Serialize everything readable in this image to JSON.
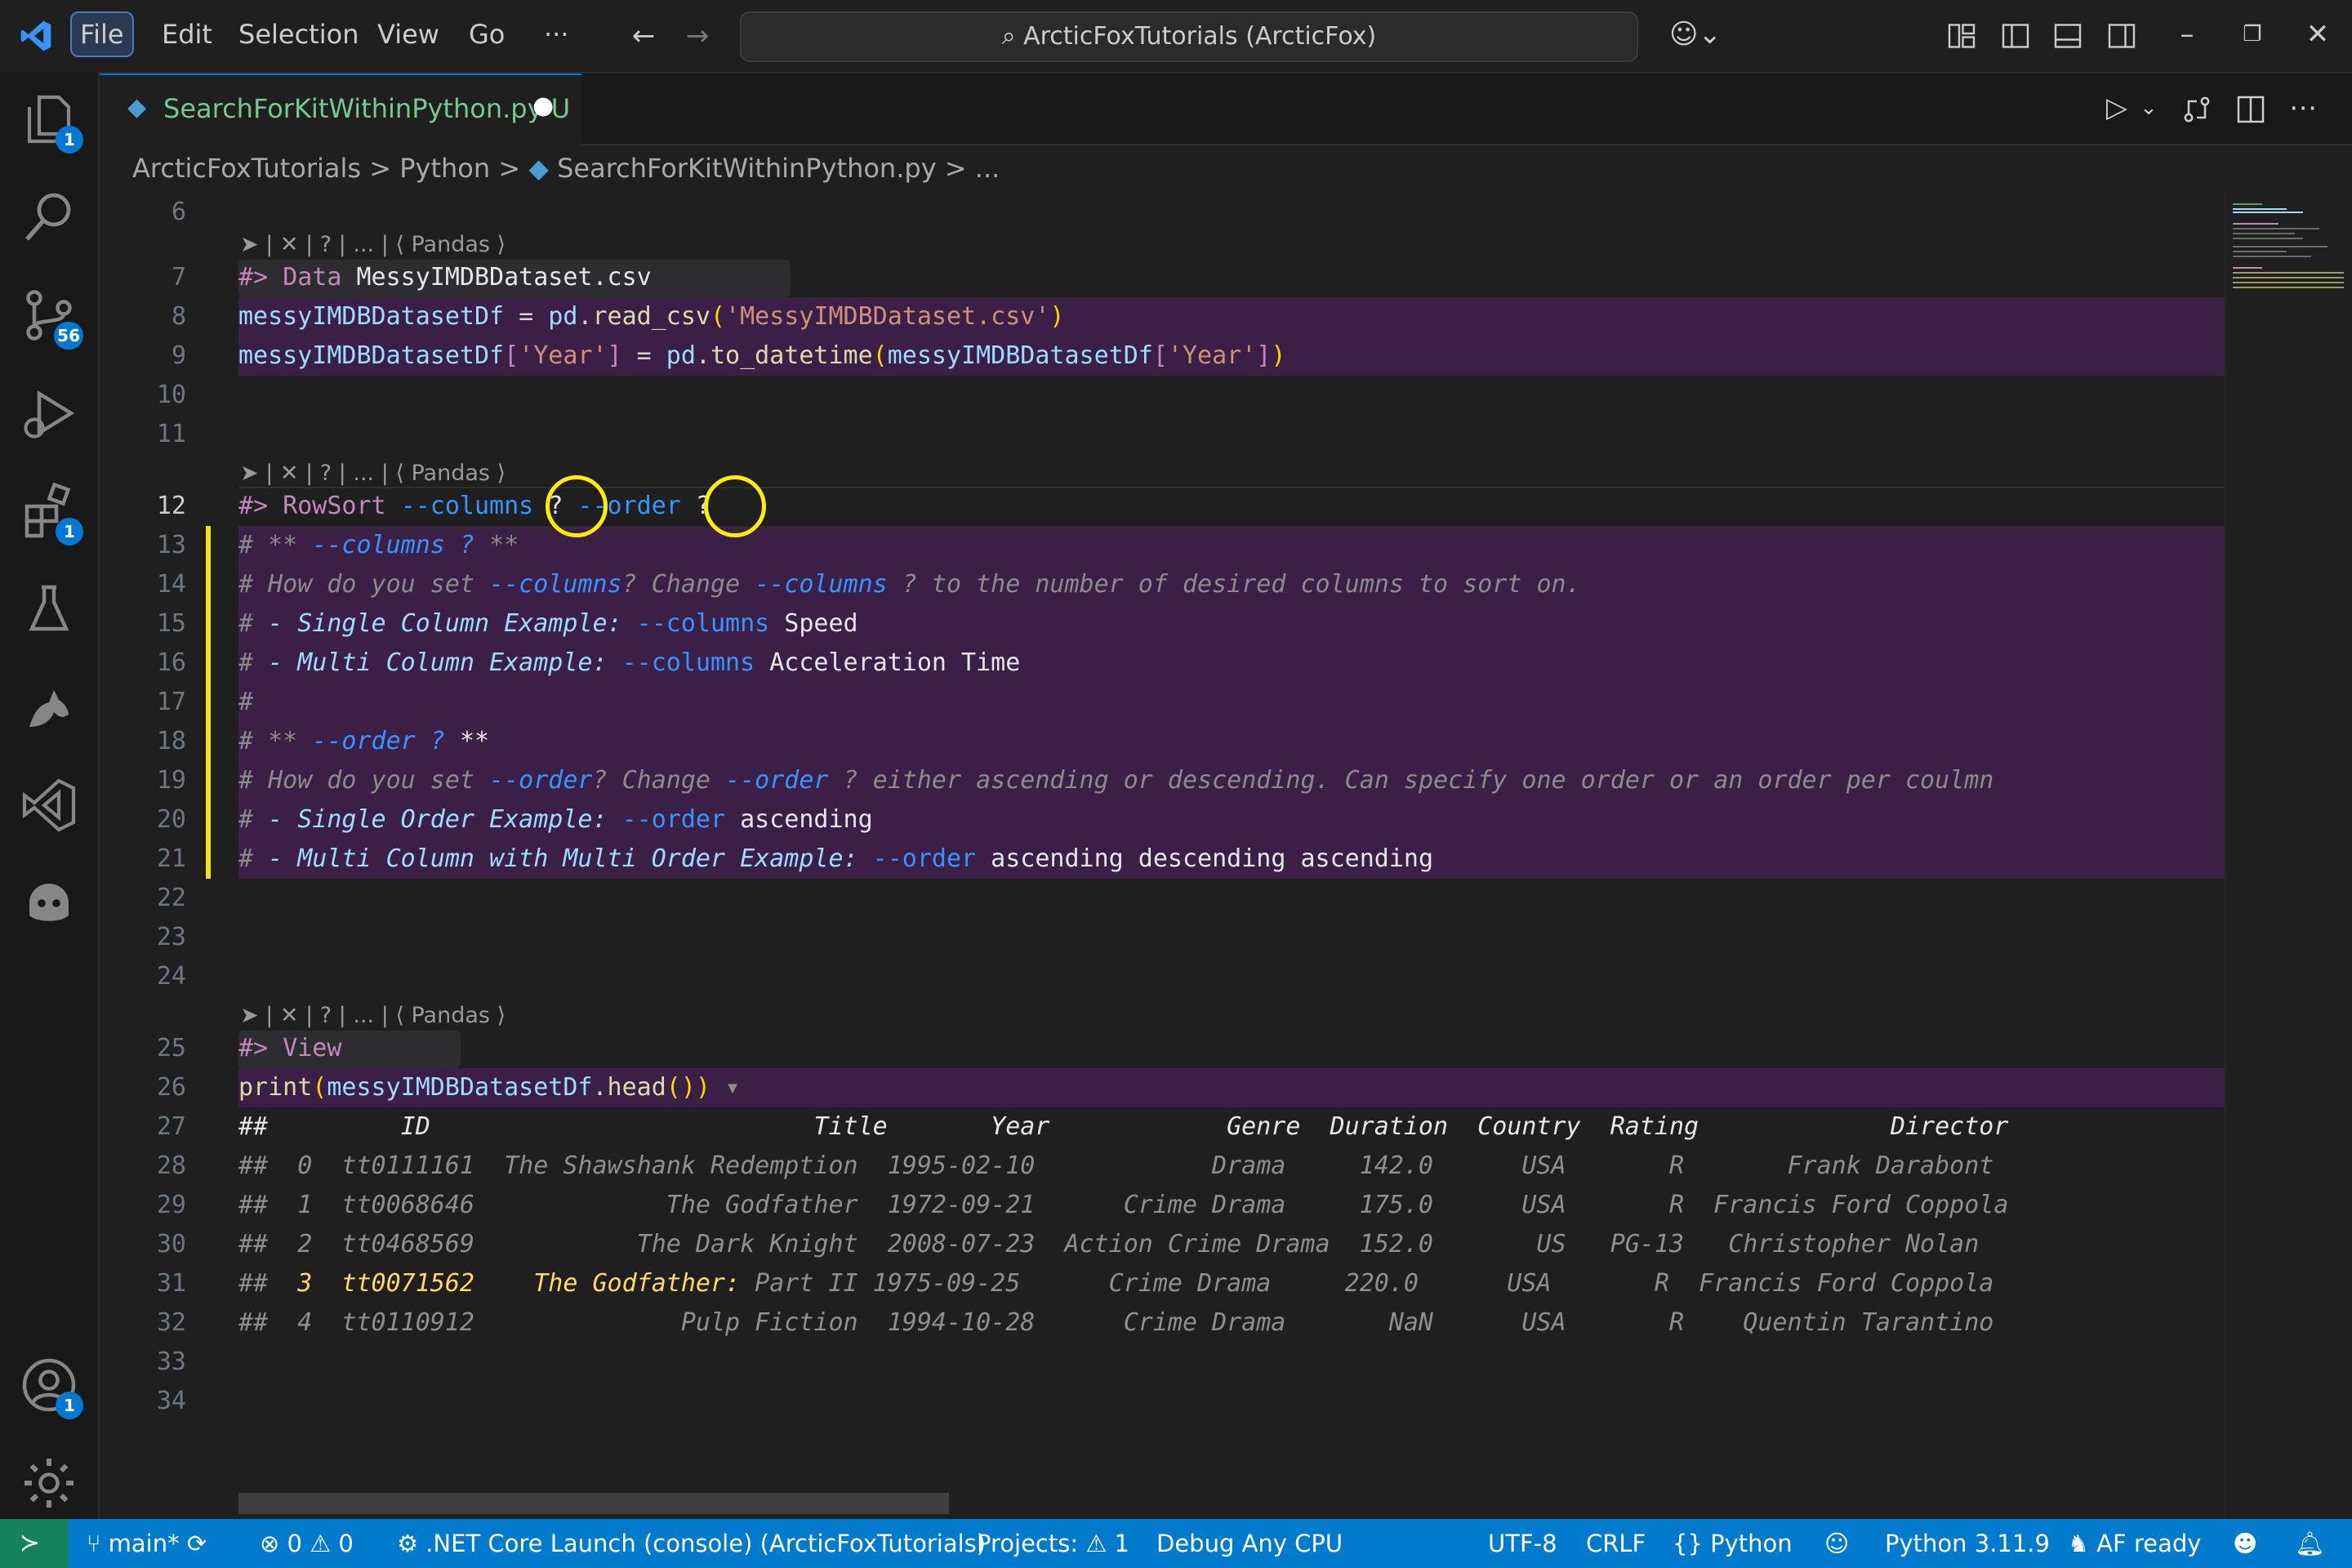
{
  "titlebar": {
    "menu": [
      "File",
      "Edit",
      "Selection",
      "View",
      "Go",
      "···"
    ],
    "search_text": "ArcticFoxTutorials (ArcticFox)",
    "copilot_icon": "copilot-icon",
    "window_controls": [
      "minimize",
      "restore",
      "close"
    ]
  },
  "activity": {
    "explorer_badge": "1",
    "scm_badge": "56",
    "extensions_badge": "1",
    "accounts_badge": "1"
  },
  "tab": {
    "filename": "SearchForKitWithinPython.py",
    "status": "U",
    "dirty_dot": "●"
  },
  "breadcrumb": {
    "parts": [
      "ArcticFoxTutorials",
      "Python",
      "SearchForKitWithinPython.py",
      "..."
    ]
  },
  "editor": {
    "codelens": "➤ | ✕ | ? | ... | ⟨ Pandas ⟩",
    "lines": {
      "l6": "6",
      "l7": "7",
      "l8": "8",
      "l9": "9",
      "l10": "10",
      "l11": "11",
      "l12": "12",
      "l13": "13",
      "l14": "14",
      "l15": "15",
      "l16": "16",
      "l17": "17",
      "l18": "18",
      "l19": "19",
      "l20": "20",
      "l21": "21",
      "l22": "22",
      "l23": "23",
      "l24": "24",
      "l25": "25",
      "l26": "26",
      "l27": "27",
      "l28": "28",
      "l29": "29",
      "l30": "30",
      "l31": "31",
      "l32": "32",
      "l33": "33",
      "l34": "34"
    },
    "code": {
      "c7_prompt": "#> ",
      "c7_kw": "Data ",
      "c7_rest": "MessyIMDBDataset.csv",
      "c8_var": "messyIMDBDatasetDf",
      "c8_eq": " = ",
      "c8_mod": "pd",
      "c8_dot": ".",
      "c8_fn": "read_csv",
      "c8_p1": "(",
      "c8_str": "'MessyIMDBDataset.csv'",
      "c8_p2": ")",
      "c9_var": "messyIMDBDatasetDf",
      "c9_b1": "[",
      "c9_str1": "'Year'",
      "c9_b2": "]",
      "c9_eq": " = ",
      "c9_mod": "pd",
      "c9_dot": ".",
      "c9_fn": "to_datetime",
      "c9_p1": "(",
      "c9_var2": "messyIMDBDatasetDf",
      "c9_b3": "[",
      "c9_str2": "'Year'",
      "c9_b4": "]",
      "c9_p2": ")",
      "c12_prompt": "#> ",
      "c12_kw": "RowSort ",
      "c12_a": "--columns ",
      "c12_q1": "?",
      "c12_b": " --order ",
      "c12_q2": "?",
      "c13_h": "# ",
      "c13_a": "** ",
      "c13_b": "--columns ? ",
      "c13_c": "**",
      "c14_h": "# ",
      "c14_a": "How do you set ",
      "c14_b": "--columns",
      "c14_c": "? Change ",
      "c14_d": "--columns",
      "c14_e": " ? to the number of desired columns to sort on.",
      "c15_h": "# ",
      "c15_a": "- Single Column Example: ",
      "c15_b": "--columns",
      "c15_c": " Speed",
      "c16_h": "# ",
      "c16_a": "- Multi Column Example: ",
      "c16_b": "--columns",
      "c16_c": " Acceleration Time",
      "c17_h": "#",
      "c18_h": "# ",
      "c18_a": "** ",
      "c18_b": "--order ? ",
      "c18_c": "**",
      "c19_h": "# ",
      "c19_a": "How do you set ",
      "c19_b": "--order",
      "c19_c": "? Change ",
      "c19_d": "--order",
      "c19_e": " ? either ascending or descending. Can specify one order or an order per coulmn",
      "c20_h": "# ",
      "c20_a": "- Single Order Example: ",
      "c20_b": "--order",
      "c20_c": " ascending",
      "c21_h": "# ",
      "c21_a": "- Multi Column with Multi Order Example: ",
      "c21_b": "--order",
      "c21_c": " ascending descending ascending",
      "c25_prompt": "#> ",
      "c25_kw": "View",
      "c26_fn": "print",
      "c26_p1": "(",
      "c26_var": "messyIMDBDatasetDf",
      "c26_dot": ".",
      "c26_fn2": "head",
      "c26_p2": "())",
      "c26_fold": " ▾"
    },
    "output": {
      "header": "##         ID                          Title       Year            Genre  Duration  Country  Rating             Director",
      "rows": [
        "##  0  tt0111161  The Shawshank Redemption  1995-02-10            Drama     142.0      USA       R       Frank Darabont",
        "##  1  tt0068646             The Godfather  1972-09-21      Crime Drama     175.0      USA       R  Francis Ford Coppola",
        "##  2  tt0468569           The Dark Knight  2008-07-23  Action Crime Drama  152.0       US   PG-13   Christopher Nolan",
        "##  ",
        "##  4  tt0110912              Pulp Fiction  1994-10-28      Crime Drama       NaN      USA       R    Quentin Tarantino"
      ],
      "row3_idx": "3  tt0071562    The Godfather:",
      "row3_rest": " Part II 1975-09-25      Crime Drama     220.0      USA       R  Francis Ford Coppola"
    }
  },
  "statusbar": {
    "branch": "main*",
    "errors": "0",
    "warnings": "0",
    "launch": ".NET Core Launch (console) (ArcticFoxTutorials)",
    "projects_label": "Projects:",
    "projects_count": "1",
    "debug": "Debug Any CPU",
    "encoding": "UTF-8",
    "eol": "CRLF",
    "language": "Python",
    "interpreter": "Python 3.11.9",
    "af": "AF ready"
  },
  "colors": {
    "accent": "#007acc",
    "cell_background": "#3c1f47",
    "highlight_circle": "#ffee00",
    "gutter_marker": "#f2e11b"
  }
}
